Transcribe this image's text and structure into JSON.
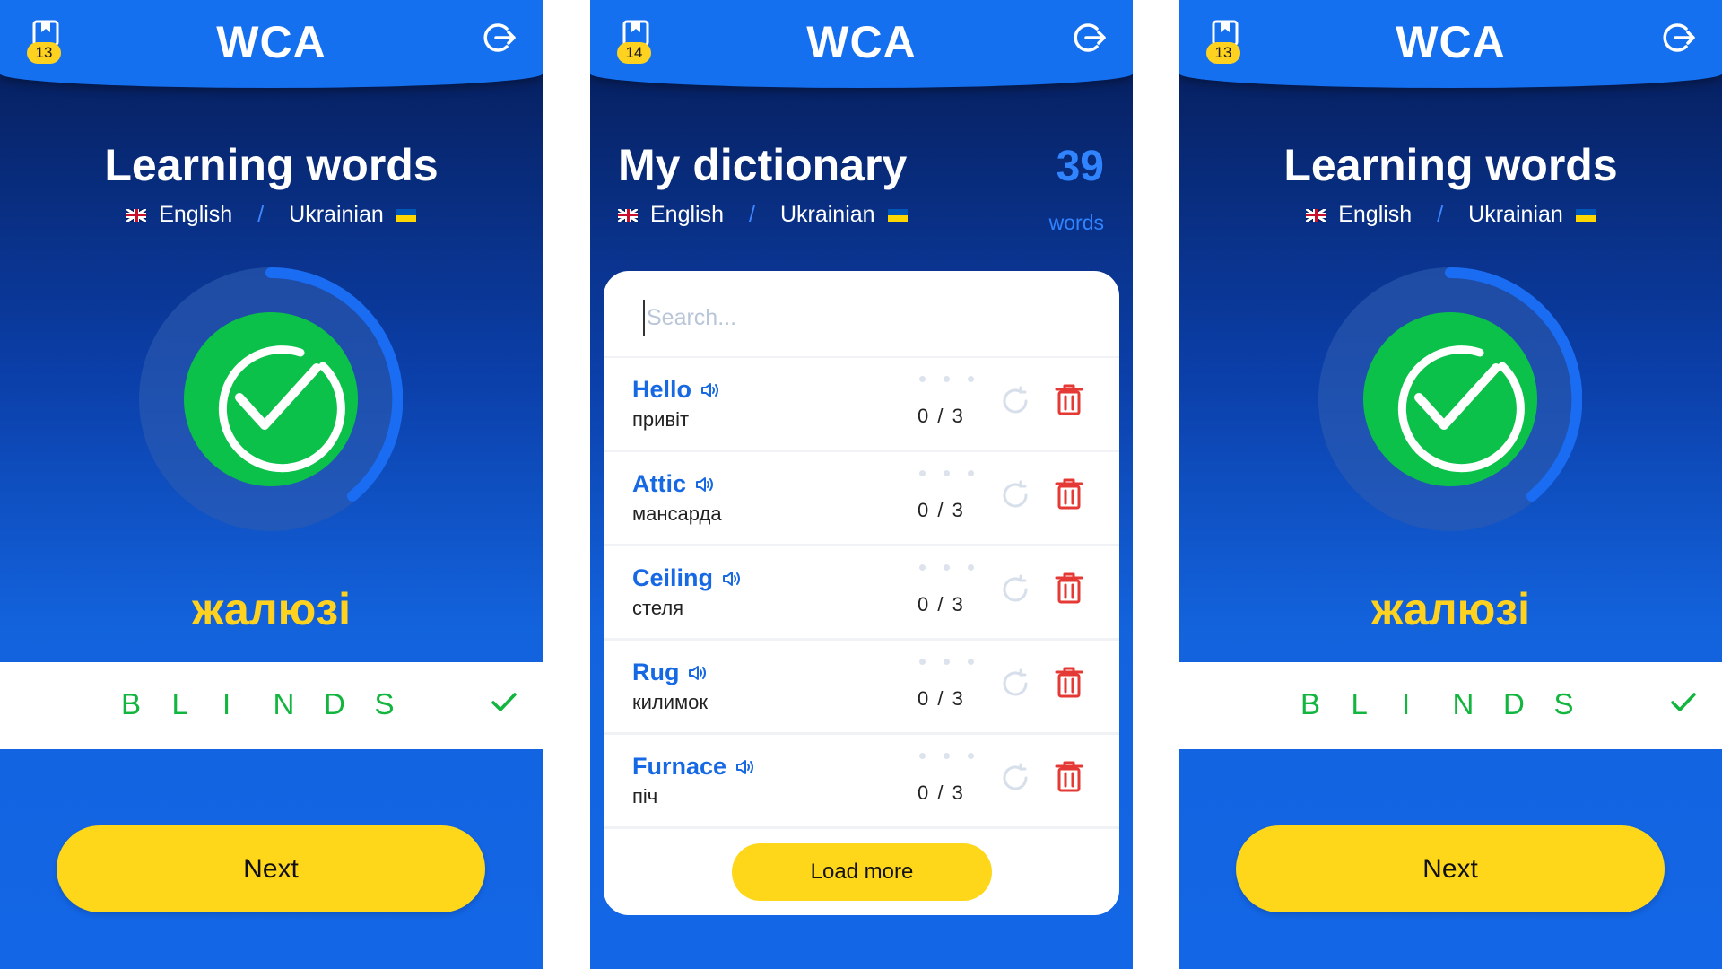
{
  "colors": {
    "header_blue": "#1570ef",
    "accent_yellow": "#ffd71a",
    "success_green": "#12b53e",
    "link_blue": "#1668e3",
    "delete_red": "#e53935"
  },
  "learning_left": {
    "app_title": "WCA",
    "bookmark_badge": "13",
    "title": "Learning words",
    "source_lang": "English",
    "separator": "/",
    "target_lang": "Ukrainian",
    "hint_word": "жалюзі",
    "answer_letters": [
      "B",
      "L",
      "I",
      "N",
      "D",
      "S"
    ],
    "progress_fraction": 0.45,
    "next_label": "Next",
    "icons": {
      "bookmark": "bookmark-icon",
      "logout": "logout-icon",
      "success": "check-circle-icon"
    }
  },
  "dictionary": {
    "app_title": "WCA",
    "bookmark_badge": "14",
    "title": "My dictionary",
    "source_lang": "English",
    "separator": "/",
    "target_lang": "Ukrainian",
    "word_count": "39",
    "word_unit": "words",
    "search_placeholder": "Search...",
    "words": [
      {
        "en": "Hello",
        "ua": "привіт",
        "progress": "0 / 3"
      },
      {
        "en": "Attic",
        "ua": "мансарда",
        "progress": "0 / 3"
      },
      {
        "en": "Ceiling",
        "ua": "стеля",
        "progress": "0 / 3"
      },
      {
        "en": "Rug",
        "ua": "килимок",
        "progress": "0 / 3"
      },
      {
        "en": "Furnace",
        "ua": "піч",
        "progress": "0 / 3"
      }
    ],
    "load_more_label": "Load more"
  },
  "learning_right": {
    "app_title": "WCA",
    "bookmark_badge": "13",
    "title": "Learning words",
    "source_lang": "English",
    "separator": "/",
    "target_lang": "Ukrainian",
    "hint_word": "жалюзі",
    "answer_letters": [
      "B",
      "L",
      "I",
      "N",
      "D",
      "S"
    ],
    "progress_fraction": 0.45,
    "next_label": "Next"
  }
}
